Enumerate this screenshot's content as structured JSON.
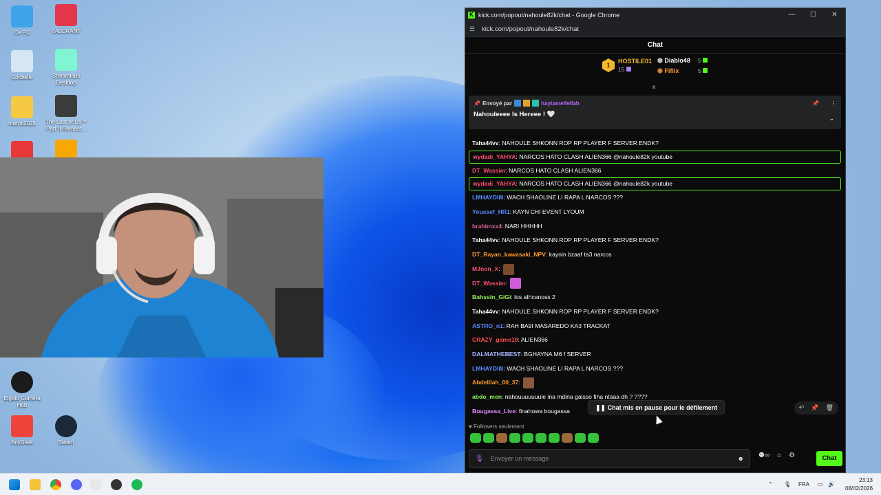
{
  "desktop": {
    "icons": [
      {
        "label": "Ce PC",
        "icon": "monitor-icon"
      },
      {
        "label": "VALORANT",
        "icon": "valorant-icon"
      },
      {
        "label": "Corbeille",
        "icon": "recycle-bin-icon"
      },
      {
        "label": "Streamlabs Desktop",
        "icon": "streamlabs-icon"
      },
      {
        "label": "maroc2025",
        "icon": "folder-icon"
      },
      {
        "label": "The Last of Us™ Part II Remast...",
        "icon": "tlou-icon"
      },
      {
        "label": "Elgato Camera Hub",
        "icon": "elgato-icon"
      },
      {
        "label": "AnyDesk",
        "icon": "anydesk-icon"
      },
      {
        "label": "Steam",
        "icon": "steam-icon"
      }
    ]
  },
  "browser": {
    "title": "kick.com/popout/nahoule82k/chat - Google Chrome",
    "url": "kick.com/popout/nahoule82k/chat"
  },
  "chat": {
    "header": "Chat",
    "leaderboard": [
      {
        "rank": "1",
        "name": "HOSTILE01",
        "count": "15"
      },
      {
        "name": "Diablo48",
        "count": "5"
      },
      {
        "name": "Fifiix",
        "count": "5"
      }
    ],
    "pinned": {
      "prefix": "Envoyé par",
      "user": "haytamelfellah",
      "text": "Nahouleeee Is Hereee ! 🤍"
    },
    "messages": [
      {
        "user": "Taha44vv",
        "text": ": NAHOULE SHKONN ROP RP PLAYER F SERVER ENDK?",
        "color": "#ffffff",
        "hl": false
      },
      {
        "user": "wydadi_YAHYA",
        "text": ": NARCOS HATO CLASH ALIEN366 @nahoule82k youtube",
        "color": "#ff4f6e",
        "hl": true
      },
      {
        "user": "DT_Wassim",
        "text": ": NARCOS HATO CLASH ALIEN366",
        "color": "#ff4f6e",
        "hl": false
      },
      {
        "user": "wydadi_YAHYA",
        "text": ": NARCOS HATO CLASH ALIEN366 @nahoule82k youtube",
        "color": "#ff4f6e",
        "hl": true
      },
      {
        "user": "LMHAYDIIII",
        "text": ": WACH SHAOLINE LI RAPA L NARCOS ???",
        "color": "#5b8cff",
        "hl": false
      },
      {
        "user": "Youssef_HR1",
        "text": ": KAYN CHI EVENT LYOUM",
        "color": "#5b8cff",
        "hl": false
      },
      {
        "user": "brahimxx4",
        "text": ": NARI HHHHH",
        "color": "#e0609a",
        "hl": false
      },
      {
        "user": "Taha44vv",
        "text": ": NAHOULE SHKONN ROP RP PLAYER F SERVER ENDK?",
        "color": "#ffffff",
        "hl": false
      },
      {
        "user": "DT_Rayan_kawasaki_NPV",
        "text": ": kaynin bzaaf ta3 narcos",
        "color": "#ff9a2e",
        "hl": false
      },
      {
        "user": "MJnon_X",
        "text": ":",
        "color": "#ff4f6e",
        "hl": false,
        "emote": "#7a4a2e"
      },
      {
        "user": "DT_Wassim",
        "text": ":",
        "color": "#ff4f6e",
        "hl": false,
        "emote": "#d15bd6"
      },
      {
        "user": "Bahssin_GiGi",
        "text": ": los africanoss 2",
        "color": "#8ef05a",
        "hl": false
      },
      {
        "user": "Taha44vv",
        "text": ": NAHOULE SHKONN ROP RP PLAYER F SERVER ENDK?",
        "color": "#ffffff",
        "hl": false
      },
      {
        "user": "ASTRO_n1",
        "text": ": RAH BA9I MASAREDO KA3 TRACKAT",
        "color": "#5b8cff",
        "hl": false
      },
      {
        "user": "CRAZY_game10",
        "text": ": ALIEN366",
        "color": "#ff4f4f",
        "hl": false
      },
      {
        "user": "DALMATHEBEST",
        "text": ": BGHAYNA M6 f SERVER",
        "color": "#a9b7ff",
        "hl": false
      },
      {
        "user": "LMHAYDIIII",
        "text": ": WACH SHAOLINE LI RAPA L NARCOS ???",
        "color": "#5b8cff",
        "hl": false
      },
      {
        "user": "Abdelilah_00_37",
        "text": ":",
        "color": "#ff9a2e",
        "hl": false,
        "emote": "#8a5a3e"
      },
      {
        "user": "abdo_men",
        "text": ": nahouuuuuuule ina mdina galsso fiha ntaaa dh ? ????",
        "color": "#8ef05a",
        "hl": false
      },
      {
        "user": "Bougassa_Live",
        "text": ": finahowa bougassa",
        "color": "#e88cff",
        "hl": false
      }
    ],
    "paused": "Chat mis en pause pour le défilement",
    "followers_only": "Followers seulement",
    "input_placeholder": "Envoyer un message",
    "send_label": "Chat"
  },
  "taskbar": {
    "lang": "FRA",
    "time": "23:13",
    "date": "08/02/2026"
  }
}
